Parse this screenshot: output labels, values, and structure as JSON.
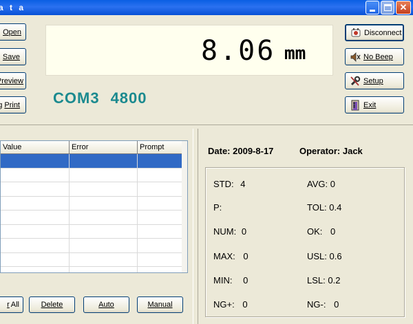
{
  "window": {
    "title": "a t a",
    "minimize_glyph": "",
    "close_glyph": "✕"
  },
  "left_buttons": [
    {
      "label": "Open"
    },
    {
      "label": "Save"
    },
    {
      "label": "Preview"
    },
    {
      "label": "Print",
      "prefix": "g"
    }
  ],
  "display": {
    "value": "8.06",
    "unit": "mm",
    "port": "COM3",
    "baud": "4800"
  },
  "right_buttons": [
    {
      "label": "Disconnect",
      "icon": "disconnect-icon"
    },
    {
      "label": "No Beep",
      "icon": "speaker-mute-icon"
    },
    {
      "label": "Setup",
      "icon": "tools-icon"
    },
    {
      "label": "Exit",
      "icon": "exit-door-icon"
    }
  ],
  "grid": {
    "columns": [
      "Value",
      "Error",
      "Prompt"
    ],
    "row_count": 9,
    "selected_row": 0
  },
  "bottom_buttons": [
    {
      "label": "All",
      "prefix": "r"
    },
    {
      "label": "Delete"
    },
    {
      "label": "Auto"
    },
    {
      "label": "Manual"
    }
  ],
  "info": {
    "date_label": "Date:",
    "date": "2009-8-17",
    "operator_label": "Operator:",
    "operator": "Jack"
  },
  "stats": {
    "std": {
      "label": "STD:",
      "value": "4"
    },
    "avg": {
      "label": "AVG:",
      "value": "0"
    },
    "p": {
      "label": "P:",
      "value": ""
    },
    "tol": {
      "label": "TOL:",
      "value": "0.4"
    },
    "num": {
      "label": "NUM:",
      "value": "0"
    },
    "ok": {
      "label": "OK:",
      "value": "0"
    },
    "max": {
      "label": "MAX:",
      "value": "0"
    },
    "usl": {
      "label": "USL:",
      "value": "0.6"
    },
    "min": {
      "label": "MIN:",
      "value": "0"
    },
    "lsl": {
      "label": "LSL:",
      "value": "0.2"
    },
    "ngplus": {
      "label": "NG+:",
      "value": "0"
    },
    "ngminus": {
      "label": "NG-:",
      "value": "0"
    }
  },
  "colors": {
    "port_text": "#1b8a8f",
    "selection": "#316ac5",
    "titlebar": "#0a5fe3"
  }
}
